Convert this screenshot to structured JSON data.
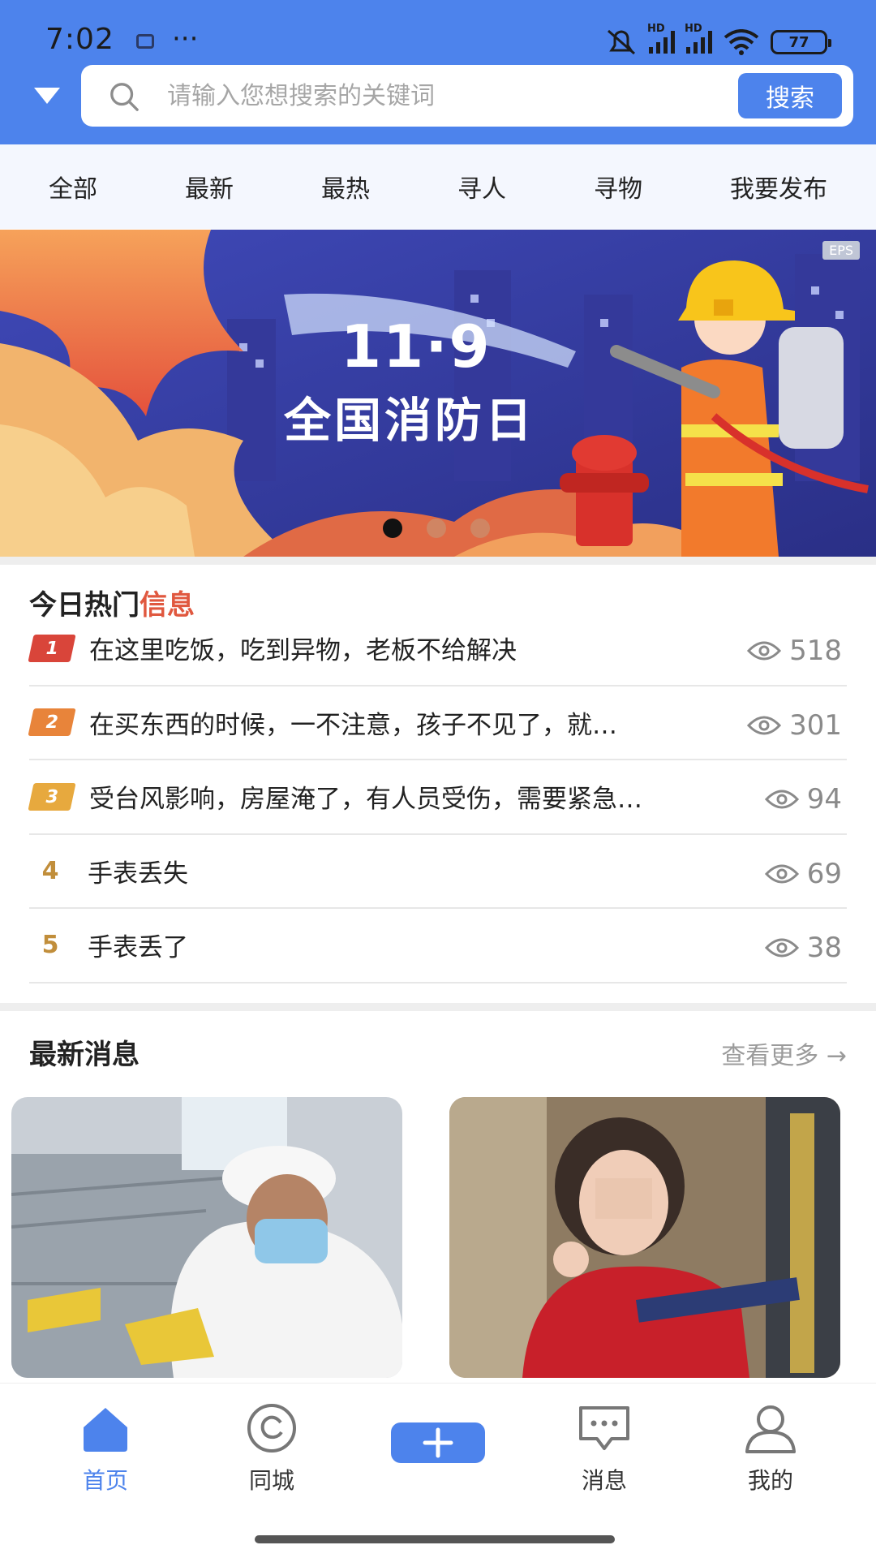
{
  "status_bar": {
    "time": "7:02",
    "dots": "···",
    "signal_1_label": "HD",
    "signal_2_label": "HD",
    "battery": "77"
  },
  "search": {
    "placeholder": "请输入您想搜索的关键词",
    "button_label": "搜索"
  },
  "tabs": [
    "全部",
    "最新",
    "最热",
    "寻人",
    "寻物",
    "我要发布"
  ],
  "banner": {
    "headline": "11·9",
    "subtitle": "全国消防日",
    "tag": "EPS",
    "slide_count": 3,
    "active_slide": 1
  },
  "hot": {
    "title_main": "今日热门",
    "title_accent": "信息",
    "items": [
      {
        "rank": "1",
        "text": "在这里吃饭，吃到异物，老板不给解决",
        "views": "518"
      },
      {
        "rank": "2",
        "text": "在买东西的时候，一不注意，孩子不见了，就…",
        "views": "301"
      },
      {
        "rank": "3",
        "text": "受台风影响，房屋淹了，有人员受伤，需要紧急…",
        "views": "94"
      },
      {
        "rank": "4",
        "text": "手表丢失",
        "views": "69"
      },
      {
        "rank": "5",
        "text": "手表丢了",
        "views": "38"
      }
    ]
  },
  "latest": {
    "title": "最新消息",
    "more_label": "查看更多 →"
  },
  "nav": {
    "items": [
      {
        "label": "首页",
        "icon": "home-icon"
      },
      {
        "label": "同城",
        "icon": "city-icon"
      },
      {
        "label": "消息",
        "icon": "message-icon"
      },
      {
        "label": "我的",
        "icon": "user-icon"
      }
    ],
    "add_icon": "plus-icon"
  },
  "colors": {
    "primary": "#4d83ec",
    "accent_red": "#e0583f",
    "rank_1": "#d9453a",
    "rank_2": "#e8843a",
    "rank_3": "#e7a93e",
    "rank_other": "#c18e3b"
  }
}
